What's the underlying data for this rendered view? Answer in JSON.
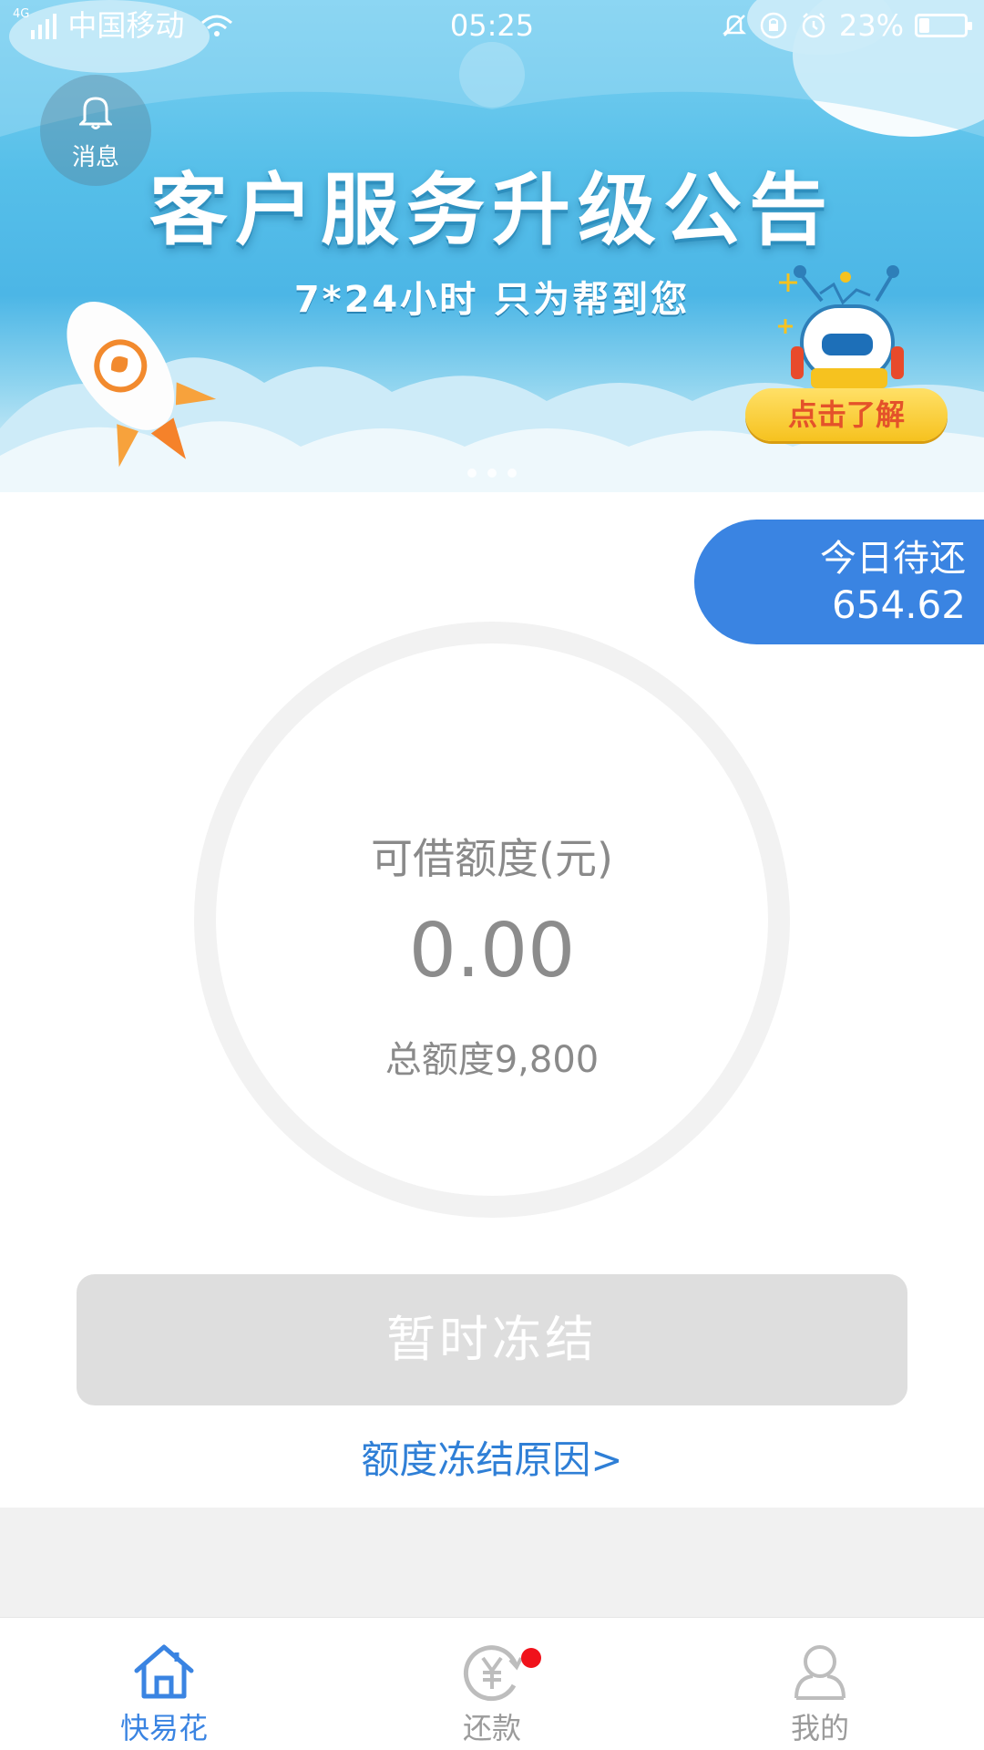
{
  "status_bar": {
    "network": "4G",
    "carrier": "中国移动",
    "time": "05:25",
    "battery": "23%",
    "battery_level": 0.23
  },
  "banner": {
    "message_label": "消息",
    "title": "客户服务升级公告",
    "subtitle": "7*24小时 只为帮到您",
    "cta_label": "点击了解"
  },
  "due_today": {
    "label": "今日待还",
    "amount": "654.62"
  },
  "credit": {
    "label": "可借额度(元)",
    "available": "0.00",
    "total": "总额度9,800"
  },
  "actions": {
    "frozen_button": "暂时冻结",
    "freeze_reason_link": "额度冻结原因>"
  },
  "tabs": [
    {
      "label": "快易花",
      "icon": "home-icon",
      "active": true
    },
    {
      "label": "还款",
      "icon": "repay-yuan-icon",
      "active": false,
      "badge": true
    },
    {
      "label": "我的",
      "icon": "user-icon",
      "active": false
    }
  ],
  "colors": {
    "accent": "#3a84e2",
    "link": "#2f7fd6",
    "disabled_button": "#dedede",
    "badge": "#f0121b",
    "cta": "#f6c21f"
  }
}
